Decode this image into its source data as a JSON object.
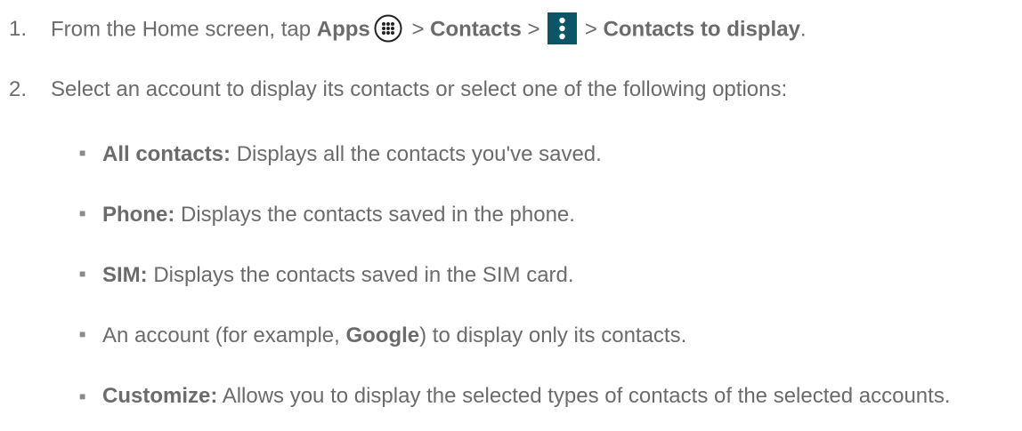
{
  "step1": {
    "number": "1.",
    "intro": "From the Home screen, tap ",
    "apps": "Apps",
    "sep1": " > ",
    "contacts": "Contacts",
    "sep2": " > ",
    "sep3": " > ",
    "contacts_to_display": "Contacts to display",
    "end": "."
  },
  "step2": {
    "number": "2.",
    "text": "Select an account to display its contacts or select one of the following options:"
  },
  "options": [
    {
      "label": "All contacts:",
      "text": " Displays all the contacts you've saved."
    },
    {
      "label": "Phone:",
      "text": " Displays the contacts saved in the phone."
    },
    {
      "label": "SIM:",
      "text": " Displays the contacts saved in the SIM card."
    },
    {
      "pre": "An account (for example, ",
      "label": "Google",
      "text": ") to display only its contacts."
    },
    {
      "label": "Customize:",
      "text": " Allows you to display the selected types of contacts of the selected accounts."
    }
  ],
  "icons": {
    "apps": "apps-grid-icon",
    "menu": "overflow-menu-icon",
    "bullet": "square-bullet-icon",
    "menu_color": "#0b5566"
  },
  "bullet_char": "■"
}
